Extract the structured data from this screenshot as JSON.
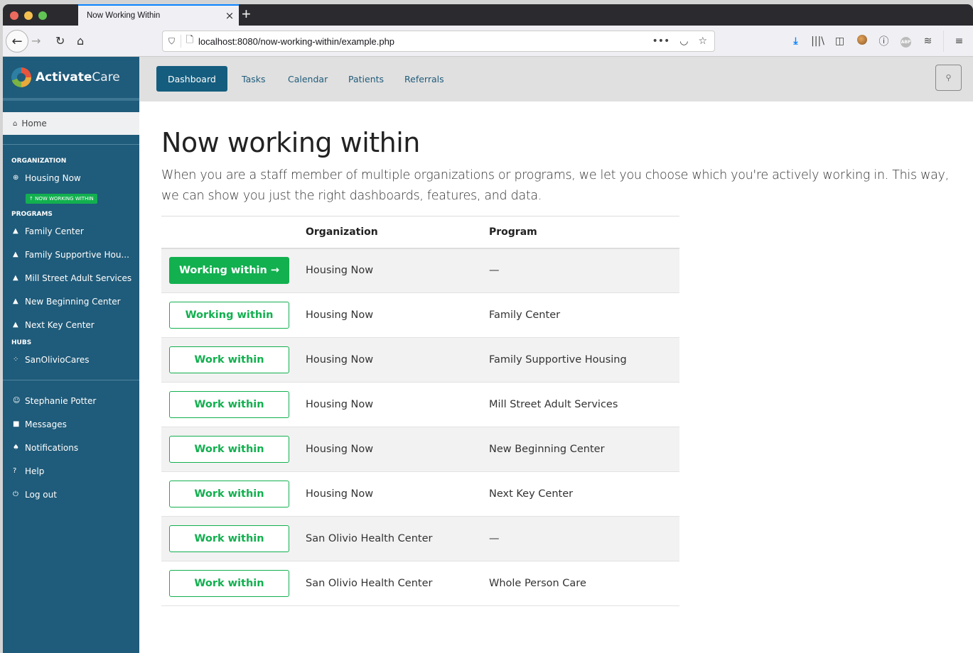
{
  "browser": {
    "tab_title": "Now Working Within",
    "url": "localhost:8080/now-working-within/example.php",
    "new_tab_label": "+",
    "tab_close_label": "×",
    "nav": {
      "back": "←",
      "forward": "→",
      "reload": "↻",
      "home": "⌂"
    },
    "url_icons": {
      "shield": "⛉",
      "page": "🗋",
      "more": "•••",
      "pocket": "◡",
      "bookmark": "☆"
    },
    "toolbar": {
      "download": "⤓",
      "library": "|||\\",
      "sidebar": "◫",
      "info": "ⓘ",
      "abp": "ABP",
      "books": "≋",
      "menu": "≡"
    }
  },
  "sidebar": {
    "brand_bold": "Activate",
    "brand_light": "Care",
    "home": {
      "icon": "⌂",
      "label": "Home"
    },
    "organization_heading": "ORGANIZATION",
    "organization": {
      "icon": "⊕",
      "label": "Housing Now"
    },
    "badge": "↑  NOW WORKING WITHIN",
    "programs_heading": "PROGRAMS",
    "programs": [
      {
        "icon": "▲",
        "label": "Family Center"
      },
      {
        "icon": "▲",
        "label": "Family Supportive Hou..."
      },
      {
        "icon": "▲",
        "label": "Mill Street Adult Services"
      },
      {
        "icon": "▲",
        "label": "New Beginning Center"
      },
      {
        "icon": "▲",
        "label": "Next Key Center"
      }
    ],
    "hubs_heading": "HUBS",
    "hubs": [
      {
        "icon": "⁘",
        "label": "SanOlivioCares"
      }
    ],
    "account": [
      {
        "icon": "☺",
        "label": "Stephanie Potter"
      },
      {
        "icon": "■",
        "label": "Messages"
      },
      {
        "icon": "♠",
        "label": "Notifications"
      },
      {
        "icon": "?",
        "label": "Help"
      },
      {
        "icon": "⏻",
        "label": "Log out"
      }
    ]
  },
  "topnav": {
    "items": [
      {
        "label": "Dashboard",
        "active": true
      },
      {
        "label": "Tasks"
      },
      {
        "label": "Calendar"
      },
      {
        "label": "Patients"
      },
      {
        "label": "Referrals"
      }
    ],
    "search_icon": "🔍"
  },
  "page": {
    "title": "Now working within",
    "description": "When you are a staff member of multiple organizations or programs, we let you choose which you're actively working in. This way, we can show you just the right dashboards, features, and data."
  },
  "table": {
    "headers": [
      "",
      "Organization",
      "Program"
    ],
    "rows": [
      {
        "button": "Working within →",
        "state": "current",
        "organization": "Housing Now",
        "program": "—"
      },
      {
        "button": "Working within",
        "state": "also",
        "organization": "Housing Now",
        "program": "Family Center"
      },
      {
        "button": "Work within",
        "state": "available",
        "organization": "Housing Now",
        "program": "Family Supportive Housing"
      },
      {
        "button": "Work within",
        "state": "available",
        "organization": "Housing Now",
        "program": "Mill Street Adult Services"
      },
      {
        "button": "Work within",
        "state": "available",
        "organization": "Housing Now",
        "program": "New Beginning Center"
      },
      {
        "button": "Work within",
        "state": "available",
        "organization": "Housing Now",
        "program": "Next Key Center"
      },
      {
        "button": "Work within",
        "state": "available",
        "organization": "San Olivio Health Center",
        "program": "—"
      },
      {
        "button": "Work within",
        "state": "available",
        "organization": "San Olivio Health Center",
        "program": "Whole Person Care"
      }
    ]
  },
  "colors": {
    "sidebar": "#1f5b7a",
    "accent": "#155d7e",
    "green": "#12b04f"
  }
}
